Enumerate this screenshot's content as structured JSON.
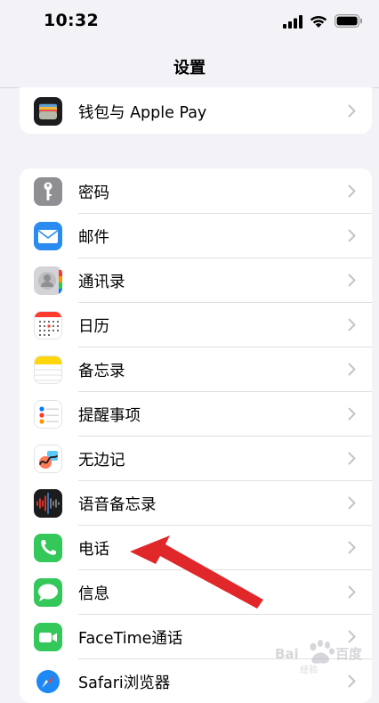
{
  "status": {
    "time": "10:32"
  },
  "nav": {
    "title": "设置"
  },
  "rows_top": [
    {
      "label": "钱包与 Apple Pay",
      "icon": "wallet-icon"
    }
  ],
  "rows": [
    {
      "label": "密码",
      "icon": "key-icon",
      "color": "#8e8e93"
    },
    {
      "label": "邮件",
      "icon": "mail-icon",
      "color": "#2a8cf0"
    },
    {
      "label": "通讯录",
      "icon": "contacts-icon",
      "color": "#c8c8cc"
    },
    {
      "label": "日历",
      "icon": "calendar-icon",
      "color": "#ffffff"
    },
    {
      "label": "备忘录",
      "icon": "notes-icon",
      "color": "#ffd60a"
    },
    {
      "label": "提醒事项",
      "icon": "reminders-icon",
      "color": "#ffffff"
    },
    {
      "label": "无边记",
      "icon": "freeform-icon",
      "color": "#ffffff"
    },
    {
      "label": "语音备忘录",
      "icon": "voice-memos-icon",
      "color": "#1c1c1e"
    },
    {
      "label": "电话",
      "icon": "phone-icon",
      "color": "#34c759"
    },
    {
      "label": "信息",
      "icon": "messages-icon",
      "color": "#34c759"
    },
    {
      "label": "FaceTime通话",
      "icon": "facetime-icon",
      "color": "#34c759"
    },
    {
      "label": "Safari浏览器",
      "icon": "safari-icon",
      "color": "#1e88f5"
    }
  ],
  "annotation": {
    "color": "#e0272a"
  },
  "watermark": {
    "brand": "Baidu",
    "sub": "jingyan"
  }
}
